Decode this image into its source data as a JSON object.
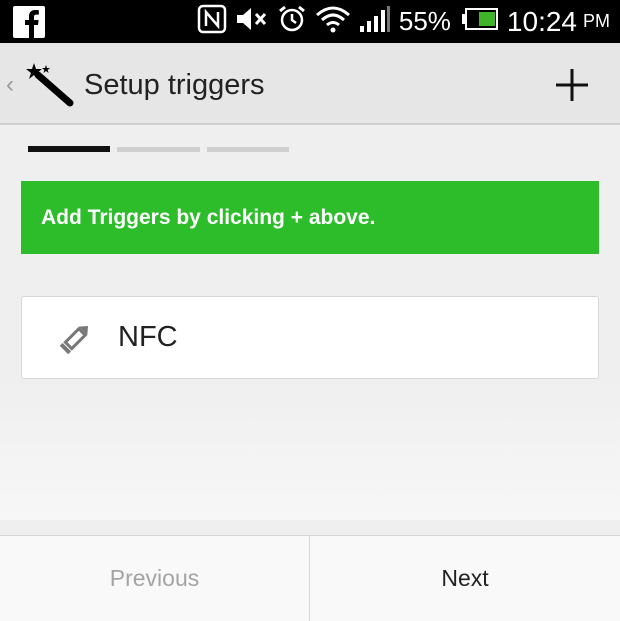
{
  "status_bar": {
    "battery_percent": "55%",
    "time": "10:24",
    "ampm": "PM",
    "icons": [
      "facebook-icon",
      "nfc-icon",
      "mute-icon",
      "alarm-icon",
      "wifi-icon",
      "signal-icon",
      "battery-icon"
    ],
    "battery_color": "#3fb52a"
  },
  "action_bar": {
    "title": "Setup triggers",
    "back_icon": "chevron-left-icon",
    "app_icon": "magic-wand-icon",
    "action_icon": "plus-icon"
  },
  "progress": {
    "total_steps": 3,
    "current_step": 1
  },
  "banner": {
    "text": "Add Triggers by clicking + above.",
    "color": "#2dbd2a"
  },
  "triggers": [
    {
      "label": "NFC",
      "icon": "pencil-icon"
    }
  ],
  "footer": {
    "previous_label": "Previous",
    "next_label": "Next"
  }
}
